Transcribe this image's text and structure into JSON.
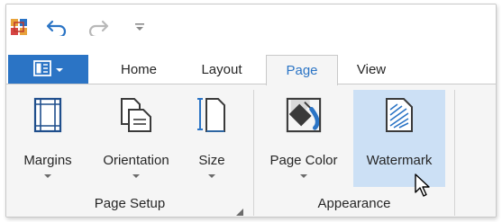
{
  "quick_access": {
    "app_icon": "app-grid-icon",
    "undo_icon": "undo-arrow-icon",
    "redo_icon": "redo-arrow-icon",
    "customize_icon": "customize-dropdown-icon"
  },
  "file_menu": {
    "icon": "document-menu-icon"
  },
  "tabs": [
    {
      "label": "Home"
    },
    {
      "label": "Layout"
    },
    {
      "label": "Page"
    },
    {
      "label": "View"
    }
  ],
  "active_tab": "Page",
  "groups": {
    "page_setup": {
      "label": "Page Setup",
      "buttons": [
        {
          "label": "Margins",
          "icon": "margins-icon"
        },
        {
          "label": "Orientation",
          "icon": "orientation-icon"
        },
        {
          "label": "Size",
          "icon": "page-size-icon"
        }
      ]
    },
    "appearance": {
      "label": "Appearance",
      "buttons": [
        {
          "label": "Page Color",
          "icon": "page-color-bucket-icon"
        },
        {
          "label": "Watermark",
          "icon": "watermark-icon"
        }
      ]
    }
  },
  "colors": {
    "accent": "#2b74c5",
    "hover": "#cce0f5",
    "ribbon_bg": "#f5f5f5"
  }
}
